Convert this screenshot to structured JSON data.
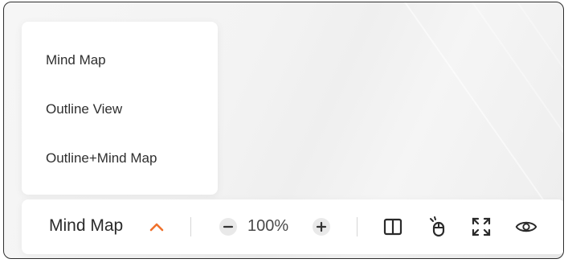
{
  "view_menu": {
    "items": [
      {
        "label": "Mind Map"
      },
      {
        "label": "Outline View"
      },
      {
        "label": "Outline+Mind Map"
      }
    ]
  },
  "toolbar": {
    "current_view": "Mind Map",
    "zoom_level": "100%",
    "accent_color": "#f0712c",
    "icons": [
      "chevron-up-icon",
      "zoom-out-icon",
      "zoom-in-icon",
      "split-view-icon",
      "mouse-icon",
      "fullscreen-icon",
      "eye-icon"
    ]
  }
}
